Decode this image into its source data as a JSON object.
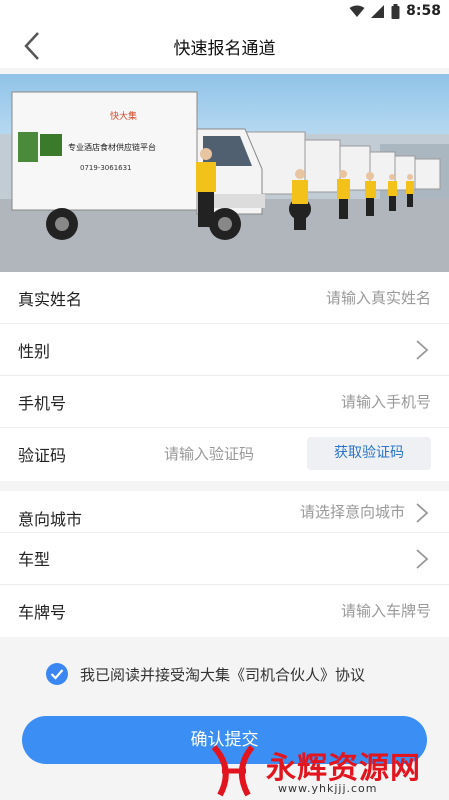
{
  "status": {
    "time": "8:58"
  },
  "header": {
    "title": "快速报名通道"
  },
  "banner": {
    "truck_ad_line1": "专业酒店食材供应链平台",
    "truck_logo": "快大集",
    "truck_phone": "0719-3061631"
  },
  "form": {
    "name": {
      "label": "真实姓名",
      "placeholder": "请输入真实姓名"
    },
    "gender": {
      "label": "性别"
    },
    "phone": {
      "label": "手机号",
      "placeholder": "请输入手机号"
    },
    "code": {
      "label": "验证码",
      "placeholder": "请输入验证码",
      "button": "获取验证码"
    },
    "city": {
      "label": "意向城市",
      "placeholder": "请选择意向城市"
    },
    "car_type": {
      "label": "车型"
    },
    "plate": {
      "label": "车牌号",
      "placeholder": "请输入车牌号"
    }
  },
  "agreement": {
    "text": "我已阅读并接受淘大集《司机合伙人》协议",
    "checked": true
  },
  "submit": {
    "label": "确认提交"
  },
  "watermark": {
    "main": "永辉资源网",
    "url": "www.yhkjjj.com"
  },
  "colors": {
    "accent": "#3b8ef3",
    "link": "#2a74c9",
    "watermark": "#e2141e"
  }
}
